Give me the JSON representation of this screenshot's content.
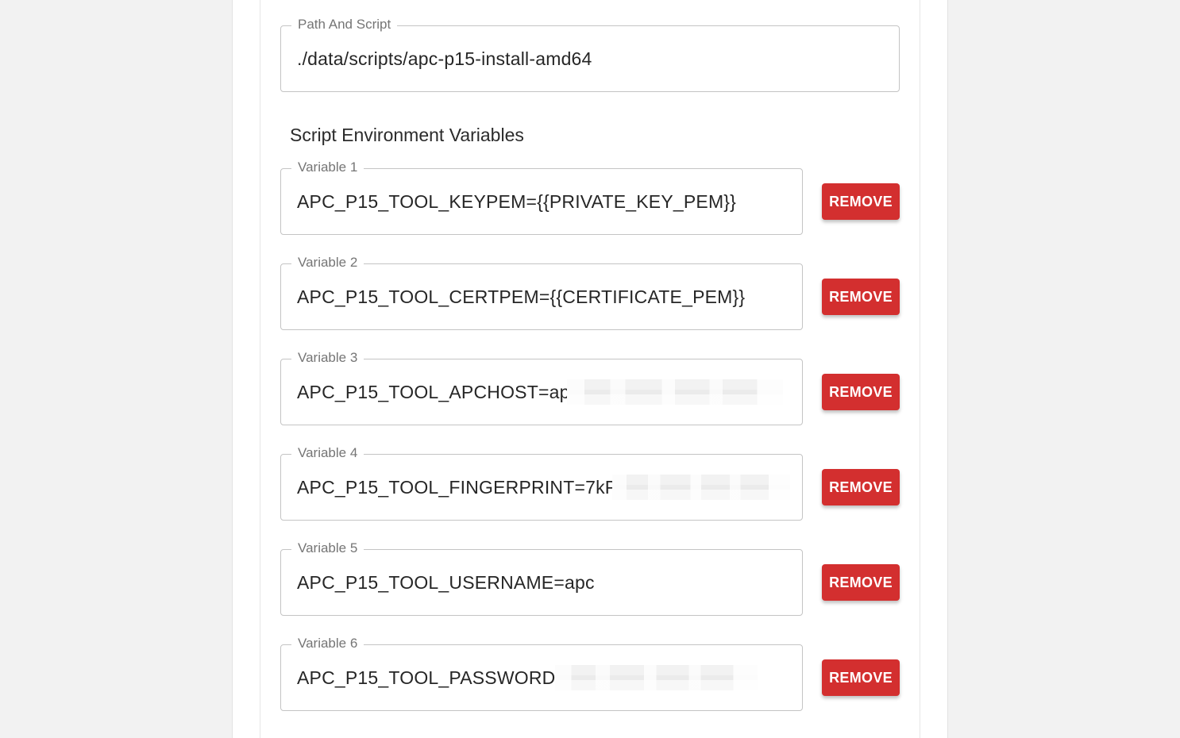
{
  "path_field": {
    "label": "Path And Script",
    "value": "./data/scripts/apc-p15-install-amd64"
  },
  "env_section": {
    "title": "Script Environment Variables"
  },
  "variables": [
    {
      "label": "Variable 1",
      "value": "APC_P15_TOOL_KEYPEM={{PRIVATE_KEY_PEM}}",
      "redacted": false
    },
    {
      "label": "Variable 2",
      "value": "APC_P15_TOOL_CERTPEM={{CERTIFICATE_PEM}}",
      "redacted": false
    },
    {
      "label": "Variable 3",
      "value": "APC_P15_TOOL_APCHOST=apc",
      "redacted": true
    },
    {
      "label": "Variable 4",
      "value": "APC_P15_TOOL_FINGERPRINT=7kPI",
      "redacted": true
    },
    {
      "label": "Variable 5",
      "value": "APC_P15_TOOL_USERNAME=apc",
      "redacted": false
    },
    {
      "label": "Variable 6",
      "value": "APC_P15_TOOL_PASSWORD=",
      "redacted": true
    }
  ],
  "remove_label": "REMOVE",
  "colors": {
    "remove_button": "#d32f2f",
    "border": "#c4c4c4",
    "background": "#f2f2f2"
  }
}
